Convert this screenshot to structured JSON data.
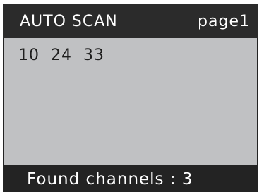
{
  "header": {
    "title": "AUTO SCAN",
    "page": "page1"
  },
  "channels": [
    "10",
    "24",
    "33"
  ],
  "footer": {
    "label": "Found channels",
    "separator": ":",
    "count": "3"
  }
}
